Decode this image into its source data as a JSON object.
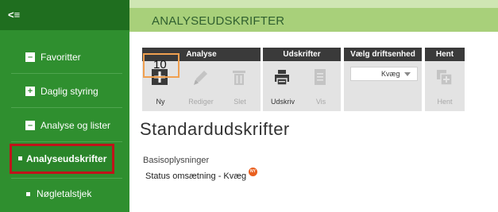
{
  "sidebar": {
    "collapse_label": "<≡",
    "items": [
      {
        "label": "Favoritter",
        "marker": "–"
      },
      {
        "label": "Daglig styring",
        "marker": "+"
      },
      {
        "label": "Analyse og lister",
        "marker": "–"
      },
      {
        "label": "Analyseudskrifter",
        "marker": ""
      },
      {
        "label": "Nøgletalstjek",
        "marker": ""
      }
    ]
  },
  "header": {
    "title": "ANALYSEUDSKRIFTER"
  },
  "ribbon": {
    "groups": [
      {
        "label": "Analyse",
        "tools": [
          {
            "label": "Ny",
            "icon": "plus-icon"
          },
          {
            "label": "Rediger",
            "icon": "pencil-icon"
          },
          {
            "label": "Slet",
            "icon": "trash-icon"
          }
        ]
      },
      {
        "label": "Udskrifter",
        "tools": [
          {
            "label": "Udskriv",
            "icon": "printer-icon"
          },
          {
            "label": "Vis",
            "icon": "document-icon"
          }
        ]
      },
      {
        "label": "Vælg driftsenhed",
        "select_value": "Kvæg"
      },
      {
        "label": "Hent",
        "tools": [
          {
            "label": "Hent",
            "icon": "add-window-icon"
          }
        ]
      }
    ],
    "highlight_number": "10"
  },
  "main": {
    "title": "Standardudskrifter",
    "section": "Basisoplysninger",
    "items": [
      {
        "label": "Status omsætning - Kvæg",
        "badge": "NY"
      }
    ]
  },
  "colors": {
    "sidebar": "#2f8f2f",
    "header": "#a8d07a",
    "highlight": "#c0131a",
    "badge": "#e95f1e"
  }
}
